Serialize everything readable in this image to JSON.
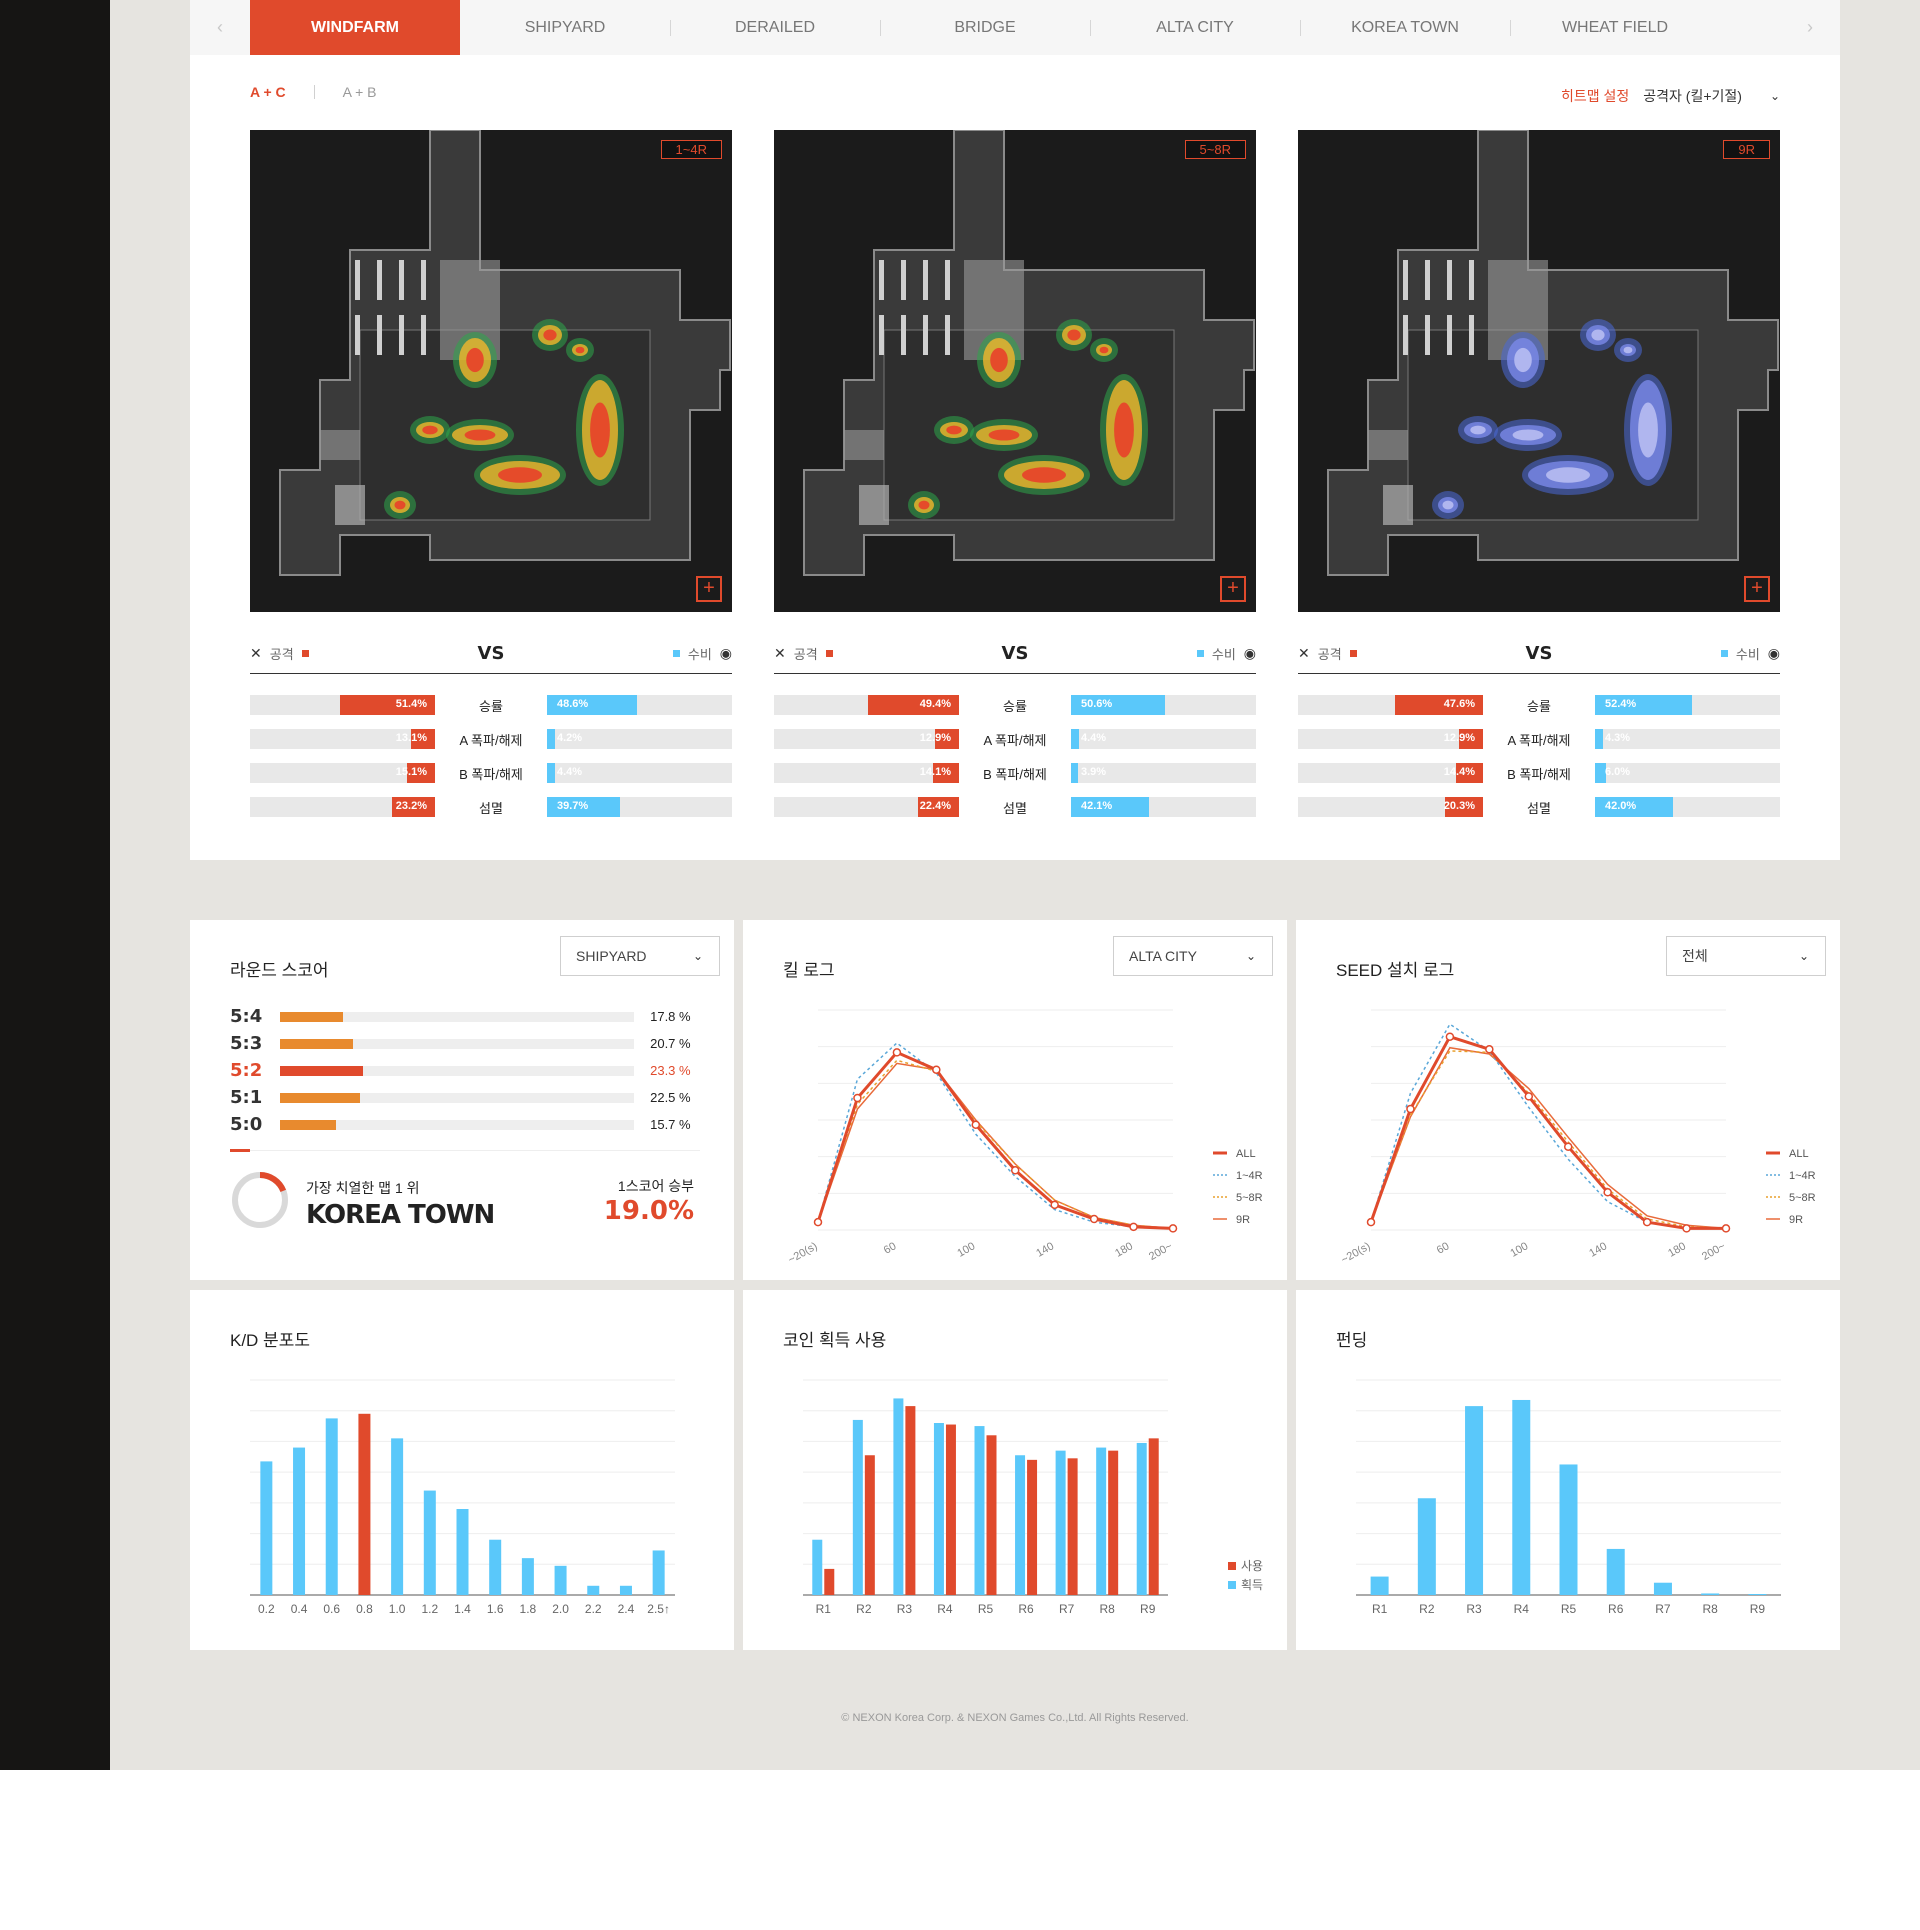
{
  "tabs": {
    "prev": "‹",
    "next": "›",
    "items": [
      "WINDFARM",
      "SHIPYARD",
      "DERAILED",
      "BRIDGE",
      "ALTA CITY",
      "KOREA TOWN",
      "WHEAT FIELD"
    ],
    "active": "WINDFARM"
  },
  "site_toggle": {
    "a_c": "A + C",
    "a_b": "A + B"
  },
  "heatmap_setting": {
    "label": "히트맵 설정",
    "value": "공격자 (킬+기절)"
  },
  "vs": {
    "attack": "공격",
    "defense": "수비",
    "vs": "VS"
  },
  "stat_labels": [
    "승률",
    "A 폭파/해제",
    "B 폭파/해제",
    "섬멸"
  ],
  "maps": [
    {
      "round": "1~4R",
      "attack": [
        "51.4%",
        "13.1%",
        "15.1%",
        "23.2%"
      ],
      "attack_values": [
        51.4,
        13.1,
        15.1,
        23.2
      ],
      "defense": [
        "48.6%",
        "4.2%",
        "4.4%",
        "39.7%"
      ],
      "defense_values": [
        48.6,
        4.2,
        4.4,
        39.7
      ]
    },
    {
      "round": "5~8R",
      "attack": [
        "49.4%",
        "12.9%",
        "14.1%",
        "22.4%"
      ],
      "attack_values": [
        49.4,
        12.9,
        14.1,
        22.4
      ],
      "defense": [
        "50.6%",
        "4.4%",
        "3.9%",
        "42.1%"
      ],
      "defense_values": [
        50.6,
        4.4,
        3.9,
        42.1
      ]
    },
    {
      "round": "9R",
      "attack": [
        "47.6%",
        "12.9%",
        "14.4%",
        "20.3%"
      ],
      "attack_values": [
        47.6,
        12.9,
        14.4,
        20.3
      ],
      "defense": [
        "52.4%",
        "4.3%",
        "6.0%",
        "42.0%"
      ],
      "defense_values": [
        52.4,
        4.3,
        6.0,
        42.0
      ]
    }
  ],
  "round_score": {
    "title": "라운드 스코어",
    "dropdown": "SHIPYARD",
    "rows": [
      {
        "score": "5:4",
        "pct": "17.8 %",
        "value": 17.8,
        "highlight": false
      },
      {
        "score": "5:3",
        "pct": "20.7 %",
        "value": 20.7,
        "highlight": false
      },
      {
        "score": "5:2",
        "pct": "23.3 %",
        "value": 23.3,
        "highlight": true
      },
      {
        "score": "5:1",
        "pct": "22.5 %",
        "value": 22.5,
        "highlight": false
      },
      {
        "score": "5:0",
        "pct": "15.7 %",
        "value": 15.7,
        "highlight": false
      }
    ],
    "fierce_label": "가장 치열한 맵 1 위",
    "fierce_map": "KOREA TOWN",
    "one_score_label": "1스코어 승부",
    "one_score_value": "19.0%",
    "one_score_fraction": 0.19
  },
  "kill_log": {
    "title": "킬 로그",
    "dropdown": "ALTA CITY",
    "chart_data": {
      "type": "line",
      "x_ticks": [
        "~20(s)",
        "60",
        "100",
        "140",
        "180",
        "200~"
      ],
      "x": [
        20,
        40,
        60,
        80,
        100,
        120,
        140,
        160,
        180,
        200
      ],
      "series": [
        {
          "name": "ALL",
          "values": [
            0.5,
            8.4,
            11.3,
            10.2,
            6.7,
            3.8,
            1.6,
            0.7,
            0.2,
            0.1
          ]
        },
        {
          "name": "1~4R",
          "values": [
            0.5,
            9.6,
            11.9,
            10.0,
            6.1,
            3.4,
            1.3,
            0.5,
            0.2,
            0.1
          ]
        },
        {
          "name": "5~8R",
          "values": [
            0.5,
            8.0,
            10.8,
            10.1,
            6.9,
            4.2,
            1.9,
            0.8,
            0.3,
            0.1
          ]
        },
        {
          "name": "9R",
          "values": [
            0.5,
            7.7,
            10.6,
            10.2,
            7.0,
            4.2,
            1.9,
            0.8,
            0.3,
            0.1
          ]
        }
      ]
    }
  },
  "seed_log": {
    "title": "SEED 설치 로그",
    "dropdown": "전체",
    "chart_data": {
      "type": "line",
      "x_ticks": [
        "~20(s)",
        "60",
        "100",
        "140",
        "180",
        "200~"
      ],
      "x": [
        20,
        40,
        60,
        80,
        100,
        120,
        140,
        160,
        180,
        200
      ],
      "series": [
        {
          "name": "ALL",
          "values": [
            0.5,
            7.7,
            12.3,
            11.5,
            8.5,
            5.3,
            2.4,
            0.5,
            0.1,
            0.1
          ]
        },
        {
          "name": "1~4R",
          "values": [
            0.5,
            8.7,
            13.1,
            11.4,
            7.8,
            4.5,
            1.8,
            0.5,
            0.1,
            0.1
          ]
        },
        {
          "name": "5~8R",
          "values": [
            0.5,
            7.3,
            11.4,
            11.3,
            8.7,
            5.6,
            2.6,
            0.7,
            0.2,
            0.1
          ]
        },
        {
          "name": "9R",
          "values": [
            0.5,
            7.2,
            11.6,
            11.2,
            9.0,
            5.9,
            2.9,
            0.9,
            0.3,
            0.1
          ]
        }
      ]
    }
  },
  "kd": {
    "title": "K/D 분포도",
    "chart_data": {
      "type": "bar",
      "categories": [
        "0.2",
        "0.4",
        "0.6",
        "0.8",
        "1.0",
        "1.2",
        "1.4",
        "1.6",
        "1.8",
        "2.0",
        "2.2",
        "2.4",
        "2.5↑"
      ],
      "values": [
        8.7,
        9.6,
        11.5,
        11.8,
        10.2,
        6.8,
        5.6,
        3.6,
        2.4,
        1.9,
        0.6,
        0.6,
        2.9
      ],
      "highlight_index": 3,
      "ylim": [
        0,
        14
      ]
    }
  },
  "coins": {
    "title": "코인 획득 사용",
    "legend_use": "사용",
    "legend_get": "획득",
    "chart_data": {
      "type": "bar",
      "categories": [
        "R1",
        "R2",
        "R3",
        "R4",
        "R5",
        "R6",
        "R7",
        "R8",
        "R9"
      ],
      "series": [
        {
          "name": "획득",
          "values": [
            3.6,
            11.4,
            12.8,
            11.2,
            11.0,
            9.1,
            9.4,
            9.6,
            9.9
          ]
        },
        {
          "name": "사용",
          "values": [
            1.7,
            9.1,
            12.3,
            11.1,
            10.4,
            8.8,
            8.9,
            9.4,
            10.2
          ]
        }
      ],
      "ylim": [
        0,
        14
      ]
    }
  },
  "funding": {
    "title": "펀딩",
    "chart_data": {
      "type": "bar",
      "categories": [
        "R1",
        "R2",
        "R3",
        "R4",
        "R5",
        "R6",
        "R7",
        "R8",
        "R9"
      ],
      "values": [
        1.2,
        6.3,
        12.3,
        12.7,
        8.5,
        3.0,
        0.8,
        0.1,
        0.05
      ],
      "ylim": [
        0,
        14
      ]
    }
  },
  "footer": "© NEXON Korea Corp. & NEXON Games Co.,Ltd. All Rights Reserved.",
  "colors": {
    "accent": "#e04a2c",
    "blue": "#5ac8fa",
    "orange": "#e88a2e"
  }
}
